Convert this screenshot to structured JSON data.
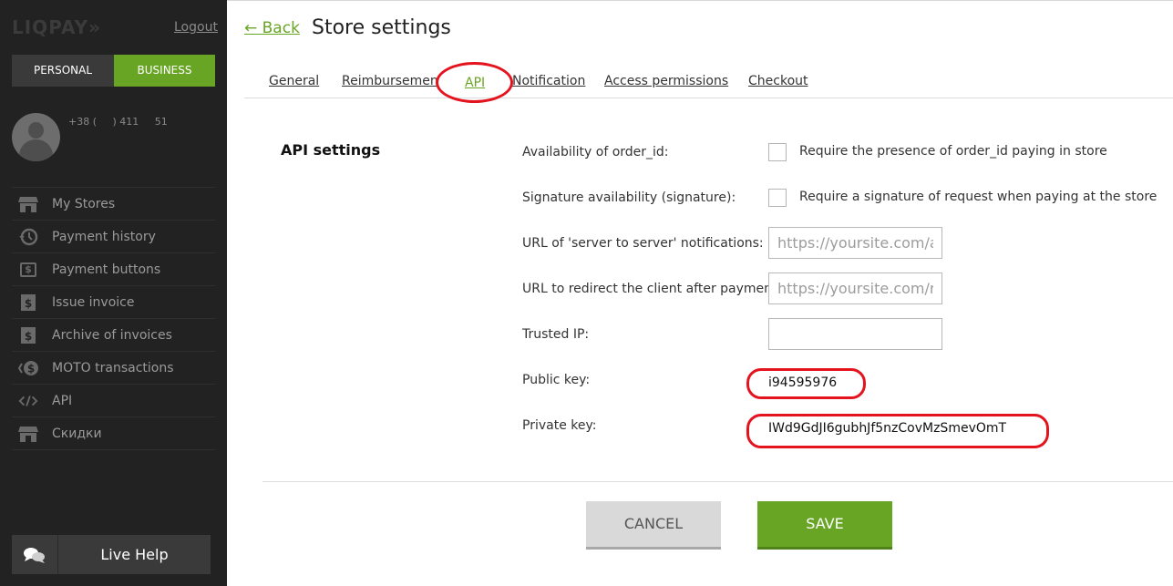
{
  "sidebar": {
    "logo": "LIQPAY",
    "logo_arrows": "»",
    "logout": "Logout",
    "mode": {
      "personal": "PERSONAL",
      "business": "BUSINESS"
    },
    "phone": "+38 (     ) 411     51",
    "menu": [
      {
        "label": "My Stores",
        "icon": "store-icon"
      },
      {
        "label": "Payment history",
        "icon": "history-icon"
      },
      {
        "label": "Payment buttons",
        "icon": "dollar-icon"
      },
      {
        "label": "Issue invoice",
        "icon": "invoice-icon"
      },
      {
        "label": "Archive of invoices",
        "icon": "archive-icon"
      },
      {
        "label": "MOTO transactions",
        "icon": "moto-icon"
      },
      {
        "label": "API",
        "icon": "code-icon"
      },
      {
        "label": "Скидки",
        "icon": "discount-store-icon"
      }
    ],
    "live_help": "Live Help"
  },
  "header": {
    "back": "← Back",
    "title": "Store settings"
  },
  "tabs": [
    "General",
    "Reimbursemen",
    "API",
    "Notification",
    "Access permissions",
    "Checkout"
  ],
  "api_settings": {
    "title": "API settings",
    "order_id_label": "Availability of order_id:",
    "order_id_text": "Require the presence of order_id paying in store",
    "signature_label": "Signature availability (signature):",
    "signature_text": "Require a signature of request when paying at the store",
    "server_url_label": "URL of 'server to server' notifications:",
    "server_url_placeholder": "https://yoursite.com/api",
    "redirect_url_label": "URL to redirect the client after payment:",
    "redirect_url_placeholder": "https://yoursite.com/redirect",
    "trusted_ip_label": "Trusted IP:",
    "public_key_label": "Public key:",
    "public_key": "i94595976",
    "private_key_label": "Private key:",
    "private_key": "IWd9GdJI6gubhJf5nzCovMzSmevOmT"
  },
  "buttons": {
    "cancel": "CANCEL",
    "save": "SAVE"
  },
  "colors": {
    "accent": "#68a524",
    "sidebar": "#222222",
    "annotation": "#e4141f"
  }
}
